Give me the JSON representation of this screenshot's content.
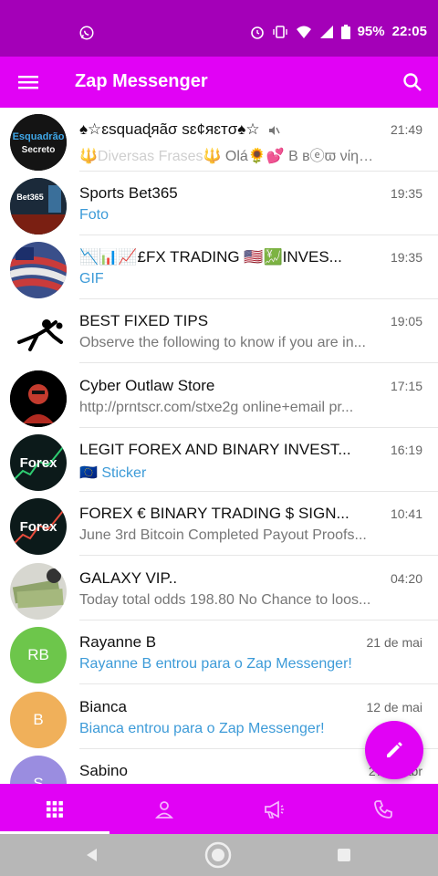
{
  "status_bar": {
    "battery": "95%",
    "time": "22:05",
    "icons": [
      "whatsapp-icon",
      "alarm-icon",
      "vibrate-icon",
      "wifi-icon",
      "signal-icon",
      "battery-icon"
    ]
  },
  "app_bar": {
    "title": "Zap Messenger",
    "menu_icon": "hamburger-menu-icon",
    "search_icon": "search-icon"
  },
  "chats": [
    {
      "name": "♠☆ɛsquaɖяãσ sɛ¢яɛтσ♠☆",
      "time": "21:49",
      "message": "Olá🌻💕 B ʙⓔϖ νίη…",
      "prefix": "🔱Diversas Frases🔱",
      "muted": true,
      "message_style": "normal"
    },
    {
      "name": "Sports Bet365",
      "time": "19:35",
      "message": "Foto",
      "message_style": "accent"
    },
    {
      "name": "📉📊📈£FX TRADING 🇺🇸💹INVES...",
      "time": "19:35",
      "message": "GIF",
      "message_style": "accent"
    },
    {
      "name": "BEST FIXED TIPS",
      "time": "19:05",
      "message": "Observe the following to know if you are in...",
      "message_style": "normal"
    },
    {
      "name": "Cyber Outlaw Store",
      "time": "17:15",
      "message": "http://prntscr.com/stxe2g  online+email pr...",
      "message_style": "normal"
    },
    {
      "name": "LEGIT FOREX AND BINARY INVEST...",
      "time": "16:19",
      "message": "🇪🇺 Sticker",
      "message_style": "accent"
    },
    {
      "name": "FOREX € BINARY TRADING $ SIGN...",
      "time": "10:41",
      "message": "June 3rd Bitcoin Completed Payout Proofs...",
      "message_style": "normal"
    },
    {
      "name": "GALAXY VIP..",
      "time": "04:20",
      "message": "Today total odds 198.80 No Chance to loos...",
      "message_style": "normal"
    },
    {
      "name": "Rayanne B",
      "time": "21 de mai",
      "message": "Rayanne B entrou para o Zap Messenger!",
      "initials": "RB",
      "color": "#6dc64b",
      "message_style": "accent"
    },
    {
      "name": "Bianca",
      "time": "12 de mai",
      "message": "Bianca entrou para o Zap Messenger!",
      "initials": "B",
      "color": "#f0b05a",
      "message_style": "accent"
    },
    {
      "name": "Sabino",
      "time": "27 de abr",
      "message": "",
      "initials": "S",
      "color": "#9a8de0",
      "message_style": "normal"
    }
  ],
  "avatar_texts": {
    "esquadrao": "Esquadrão Secreto",
    "bet365": "Bet365",
    "forex": "Forex"
  },
  "bottom_nav": {
    "tabs": [
      "chats-grid-icon",
      "contacts-icon",
      "channels-megaphone-icon",
      "calls-phone-icon"
    ],
    "active": 0
  },
  "colors": {
    "status_bar": "#a400b8",
    "primary": "#e102f5",
    "accent_text": "#3d9bd8",
    "system_nav": "#b7b7b7"
  }
}
